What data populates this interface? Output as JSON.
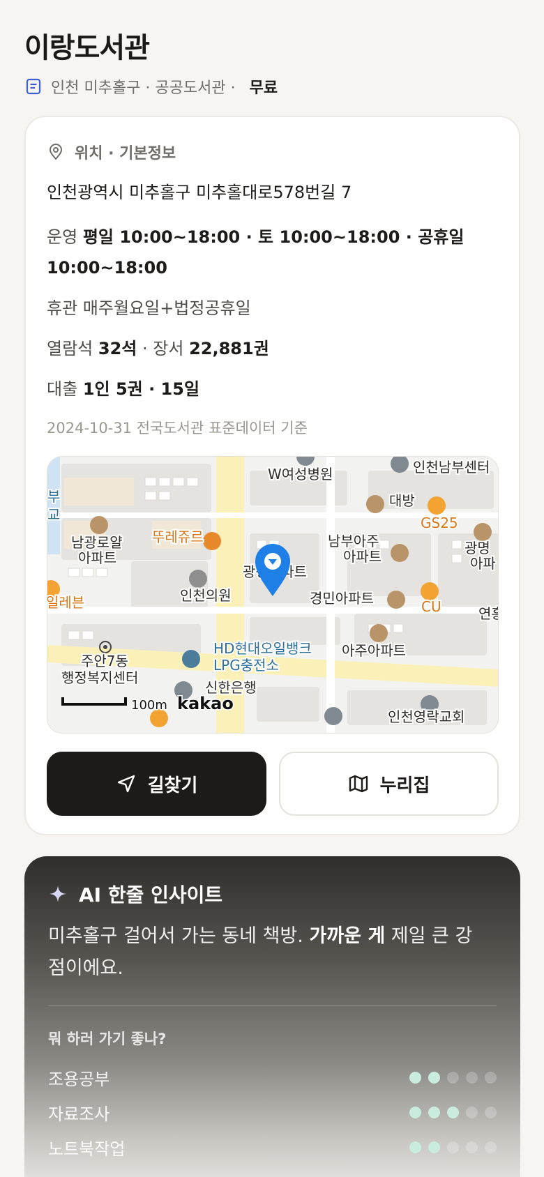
{
  "header": {
    "title": "이랑도서관",
    "location_type": "인천 미추홀구 · 공공도서관 ·",
    "fee": "무료"
  },
  "info": {
    "section_title": "위치 · 기본정보",
    "address": "인천광역시 미추홀구 미추홀대로578번길 7",
    "hours_label": "운영",
    "hours_value": "평일 10:00~18:00 · 토 10:00~18:00 · 공휴일 10:00~18:00",
    "closed_text": "휴관 매주월요일+법정공휴일",
    "seats_label": "열람석",
    "seats_value": "32석",
    "books_label": "· 장서",
    "books_value": "22,881권",
    "loan_label": "대출",
    "loan_value": "1인 5권 · 15일",
    "source": "2024-10-31 전국도서관 표준데이터 기준"
  },
  "map": {
    "labels": {
      "w_hospital": "W여성병원",
      "incheon_nambu": "인천남부센터",
      "daebang": "대방",
      "gs25": "GS25",
      "namgwang_1": "남광로얄",
      "namgwang_2": "아파트",
      "tous": "뚜레쥬르",
      "nambu_apt_1": "남부아주",
      "nambu_apt_2": "아파트",
      "gwangmyeong_1": "광명",
      "gwangmyeong_2": "아파",
      "gwangseong": "광성아파트",
      "incheon_clinic": "인천의원",
      "seven_eleven": "일레븐",
      "gyeongmin": "경민아파트",
      "cu": "CU",
      "yeonheung": "연흥",
      "hd_oil_1": "HD현대오일뱅크",
      "hd_oil_2": "LPG충전소",
      "aju_apt": "아주아파트",
      "juan_1": "주안7동",
      "juan_2": "행정복지센터",
      "shinhan": "신한은행",
      "scale": "100m",
      "brand": "kakao",
      "church": "인천영락교회",
      "left_edge_1": "부",
      "left_edge_2": "교"
    }
  },
  "actions": {
    "directions": "길찾기",
    "website": "누리집"
  },
  "ai": {
    "title": "AI 한줄 인사이트",
    "text_before": "미추홀구 걸어서 가는 동네 책방. ",
    "text_bold": "가까운 게",
    "text_after": " 제일 큰 강점이에요.",
    "question": "뭐 하러 가기 좋나?",
    "items": [
      {
        "label": "조용공부",
        "score": 2,
        "max": 5
      },
      {
        "label": "자료조사",
        "score": 3,
        "max": 5
      },
      {
        "label": "노트북작업",
        "score": 2,
        "max": 5
      }
    ]
  }
}
